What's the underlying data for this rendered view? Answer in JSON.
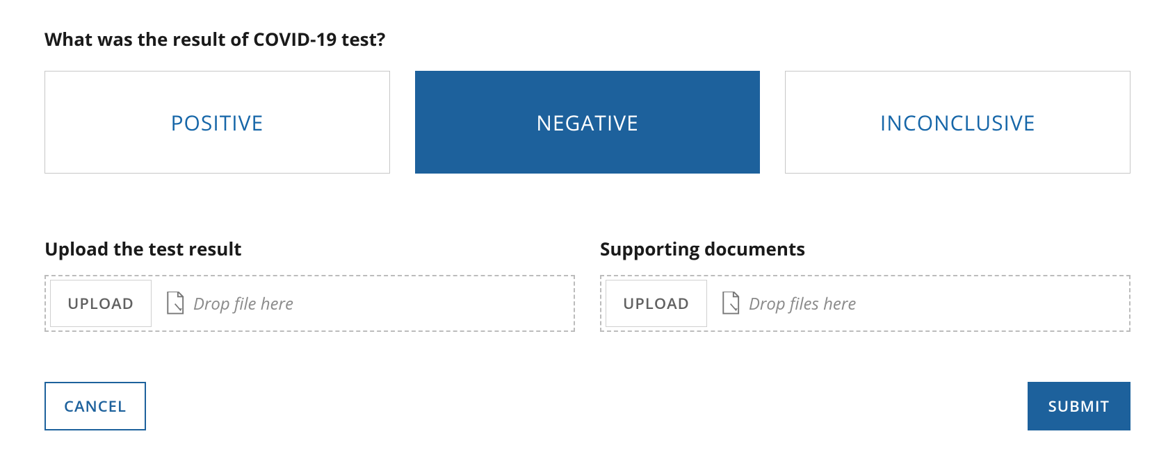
{
  "question": {
    "title": "What was the result of COVID-19 test?",
    "options": [
      {
        "label": "POSITIVE",
        "selected": false
      },
      {
        "label": "NEGATIVE",
        "selected": true
      },
      {
        "label": "INCONCLUSIVE",
        "selected": false
      }
    ]
  },
  "uploads": {
    "test_result": {
      "label": "Upload the test result",
      "button": "UPLOAD",
      "placeholder": "Drop file here"
    },
    "supporting": {
      "label": "Supporting documents",
      "button": "UPLOAD",
      "placeholder": "Drop files here"
    }
  },
  "actions": {
    "cancel": "CANCEL",
    "submit": "SUBMIT"
  },
  "colors": {
    "primary": "#1d619c",
    "link": "#1666a8",
    "border": "#c7c7c7",
    "muted": "#8a8a8a"
  }
}
